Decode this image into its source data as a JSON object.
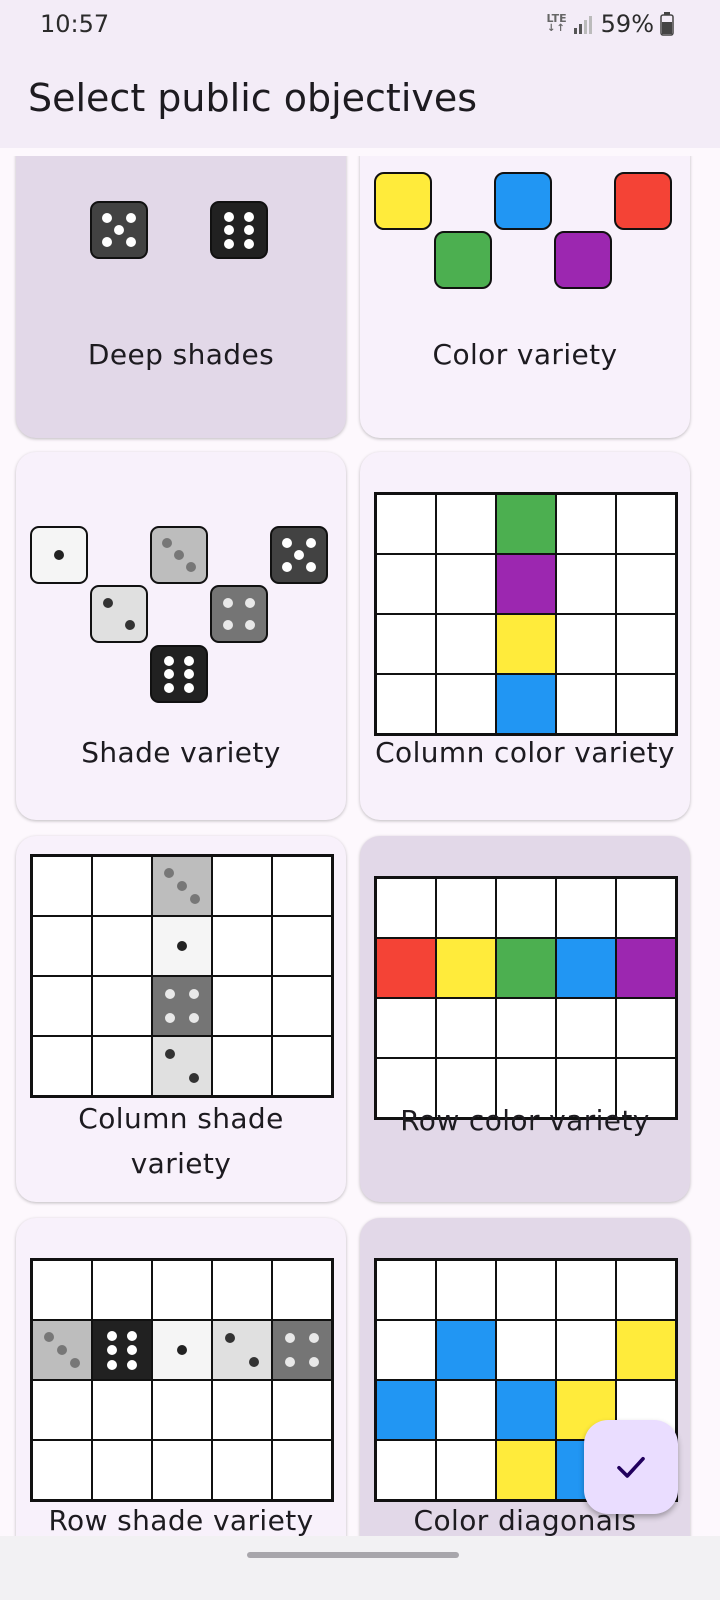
{
  "status_bar": {
    "time": "10:57",
    "network": "LTE",
    "battery": "59%"
  },
  "app_bar": {
    "title": "Select public objectives"
  },
  "colors": {
    "red": "#f44336",
    "yellow": "#ffeb3b",
    "green": "#4caf50",
    "blue": "#2196f3",
    "purple": "#9c27b0",
    "shade1": "#f5f5f5",
    "shade2": "#e0e0e0",
    "shade3": "#bdbdbd",
    "shade4": "#757575",
    "shade5": "#424242",
    "shade6": "#212121",
    "selected_card": "#e2d8e8",
    "card": "#f8f1fb",
    "fab": "#eaddff"
  },
  "objectives": [
    {
      "label": "Deep shades",
      "selected": true
    },
    {
      "label": "Color variety",
      "selected": false
    },
    {
      "label": "Shade variety",
      "selected": false
    },
    {
      "label": "Column color variety",
      "selected": false
    },
    {
      "label": "Column shade variety",
      "selected": false
    },
    {
      "label": "Row color variety",
      "selected": true
    },
    {
      "label": "Row shade variety",
      "selected": false
    },
    {
      "label": "Color diagonals",
      "selected": true
    }
  ],
  "fab": {
    "icon": "check-icon"
  },
  "nav": {
    "icon": "home-handle"
  }
}
